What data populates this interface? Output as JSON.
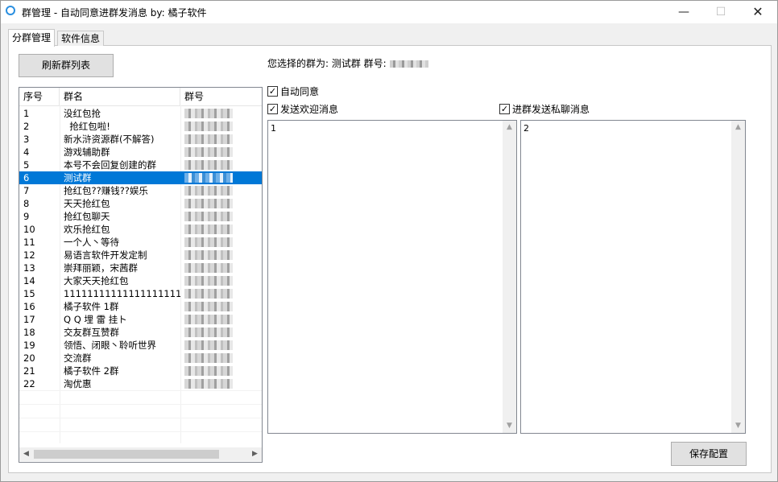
{
  "window": {
    "title": "群管理 - 自动同意进群发消息 by: 橘子软件",
    "minimize_glyph": "—",
    "maximize_glyph": "☐",
    "close_glyph": "✕"
  },
  "tabs": [
    {
      "label": "分群管理",
      "active": true
    },
    {
      "label": "软件信息",
      "active": false
    }
  ],
  "refresh_button": "刷新群列表",
  "selected_info_text": "您选择的群为: 测试群 群号:",
  "list": {
    "columns": [
      "序号",
      "群名",
      "群号"
    ],
    "selected_index": 5,
    "rows": [
      {
        "num": "1",
        "name": "没红包抢"
      },
      {
        "num": "2",
        "name": "  抢红包啦!"
      },
      {
        "num": "3",
        "name": "新水浒资源群(不解答)"
      },
      {
        "num": "4",
        "name": "游戏辅助群"
      },
      {
        "num": "5",
        "name": "本号不会回复创建的群"
      },
      {
        "num": "6",
        "name": "测试群"
      },
      {
        "num": "7",
        "name": "抢红包??赚钱??娱乐"
      },
      {
        "num": "8",
        "name": "天天抢红包"
      },
      {
        "num": "9",
        "name": "抢红包聊天"
      },
      {
        "num": "10",
        "name": "欢乐抢红包"
      },
      {
        "num": "11",
        "name": "一个人丶等待"
      },
      {
        "num": "12",
        "name": "易语言软件开发定制"
      },
      {
        "num": "13",
        "name": "崇拜丽颖，宋茜群"
      },
      {
        "num": "14",
        "name": "大家天天抢红包"
      },
      {
        "num": "15",
        "name": "11111111111111111111"
      },
      {
        "num": "16",
        "name": "橘子软件 1群"
      },
      {
        "num": "17",
        "name": "Q Q 埋 雷 挂ト"
      },
      {
        "num": "18",
        "name": "交友群互赞群"
      },
      {
        "num": "19",
        "name": "领悟、闭眼丶聆听世界"
      },
      {
        "num": "20",
        "name": "交流群"
      },
      {
        "num": "21",
        "name": "橘子软件 2群"
      },
      {
        "num": "22",
        "name": "淘优惠"
      }
    ]
  },
  "checkboxes": {
    "auto_agree": {
      "label": "自动同意",
      "checked": true
    },
    "send_welcome": {
      "label": "发送欢迎消息",
      "checked": true
    },
    "send_private": {
      "label": "进群发送私聊消息",
      "checked": true
    }
  },
  "welcome_text": "1",
  "private_text": "2",
  "save_button": "保存配置",
  "colors": {
    "selection": "#0078d7",
    "accent_icon": "#2a8fe0"
  }
}
